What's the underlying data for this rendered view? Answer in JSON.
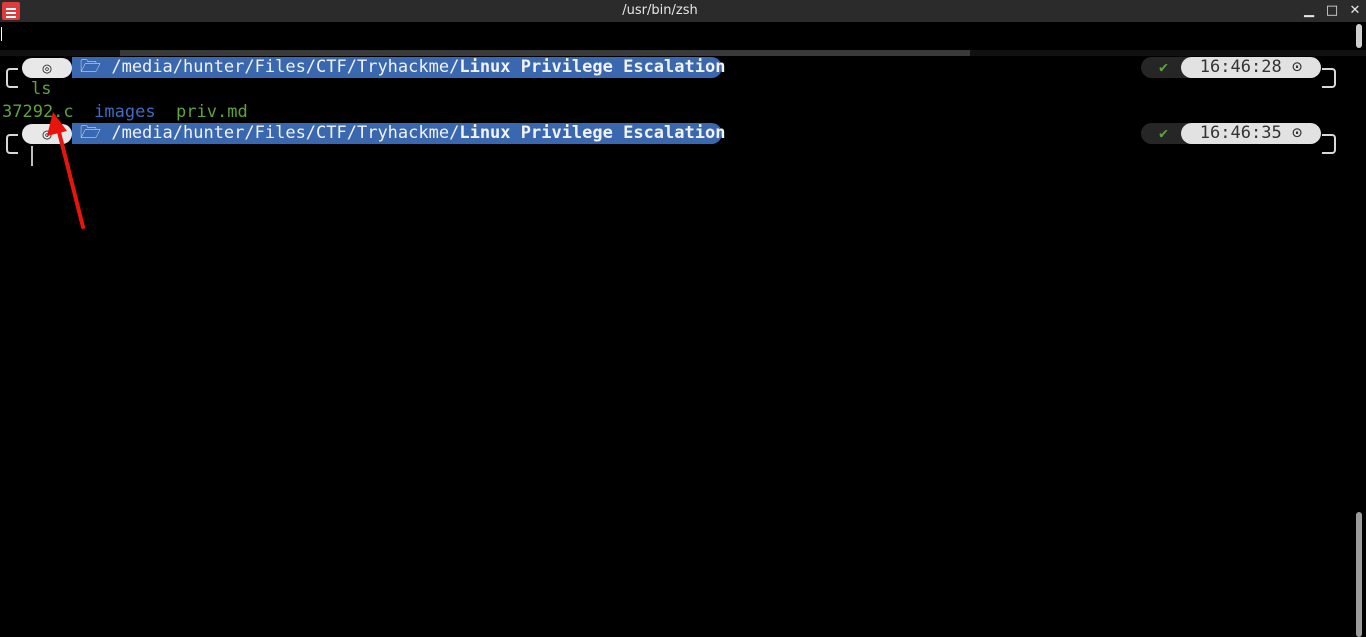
{
  "window": {
    "title": "/usr/bin/zsh",
    "icon": "terminal-app-icon",
    "minimize": "▁",
    "maximize": "□",
    "close": "✕"
  },
  "prompts": [
    {
      "os_icon": "◎",
      "folder_icon": "🗁",
      "path_plain": "/media/hunter/Files/CTF/Tryhackme/",
      "path_bold": "Linux Privilege Escalation",
      "status": "✔",
      "time": "16:46:28",
      "clock_icon": "⊙",
      "command": "ls"
    },
    {
      "os_icon": "◎",
      "folder_icon": "🗁",
      "path_plain": "/media/hunter/Files/CTF/Tryhackme/",
      "path_bold": "Linux Privilege Escalation",
      "status": "✔",
      "time": "16:46:35",
      "clock_icon": "⊙",
      "command": ""
    }
  ],
  "ls_output": [
    {
      "name": "37292.c",
      "color": "#5fa33b"
    },
    {
      "name": "images",
      "color": "#3d6dbf"
    },
    {
      "name": "priv.md",
      "color": "#5fa33b"
    }
  ],
  "colors": {
    "path_bg": "#3a68b0",
    "status_ok": "#5fa33b",
    "arrow": "#e8150f"
  }
}
